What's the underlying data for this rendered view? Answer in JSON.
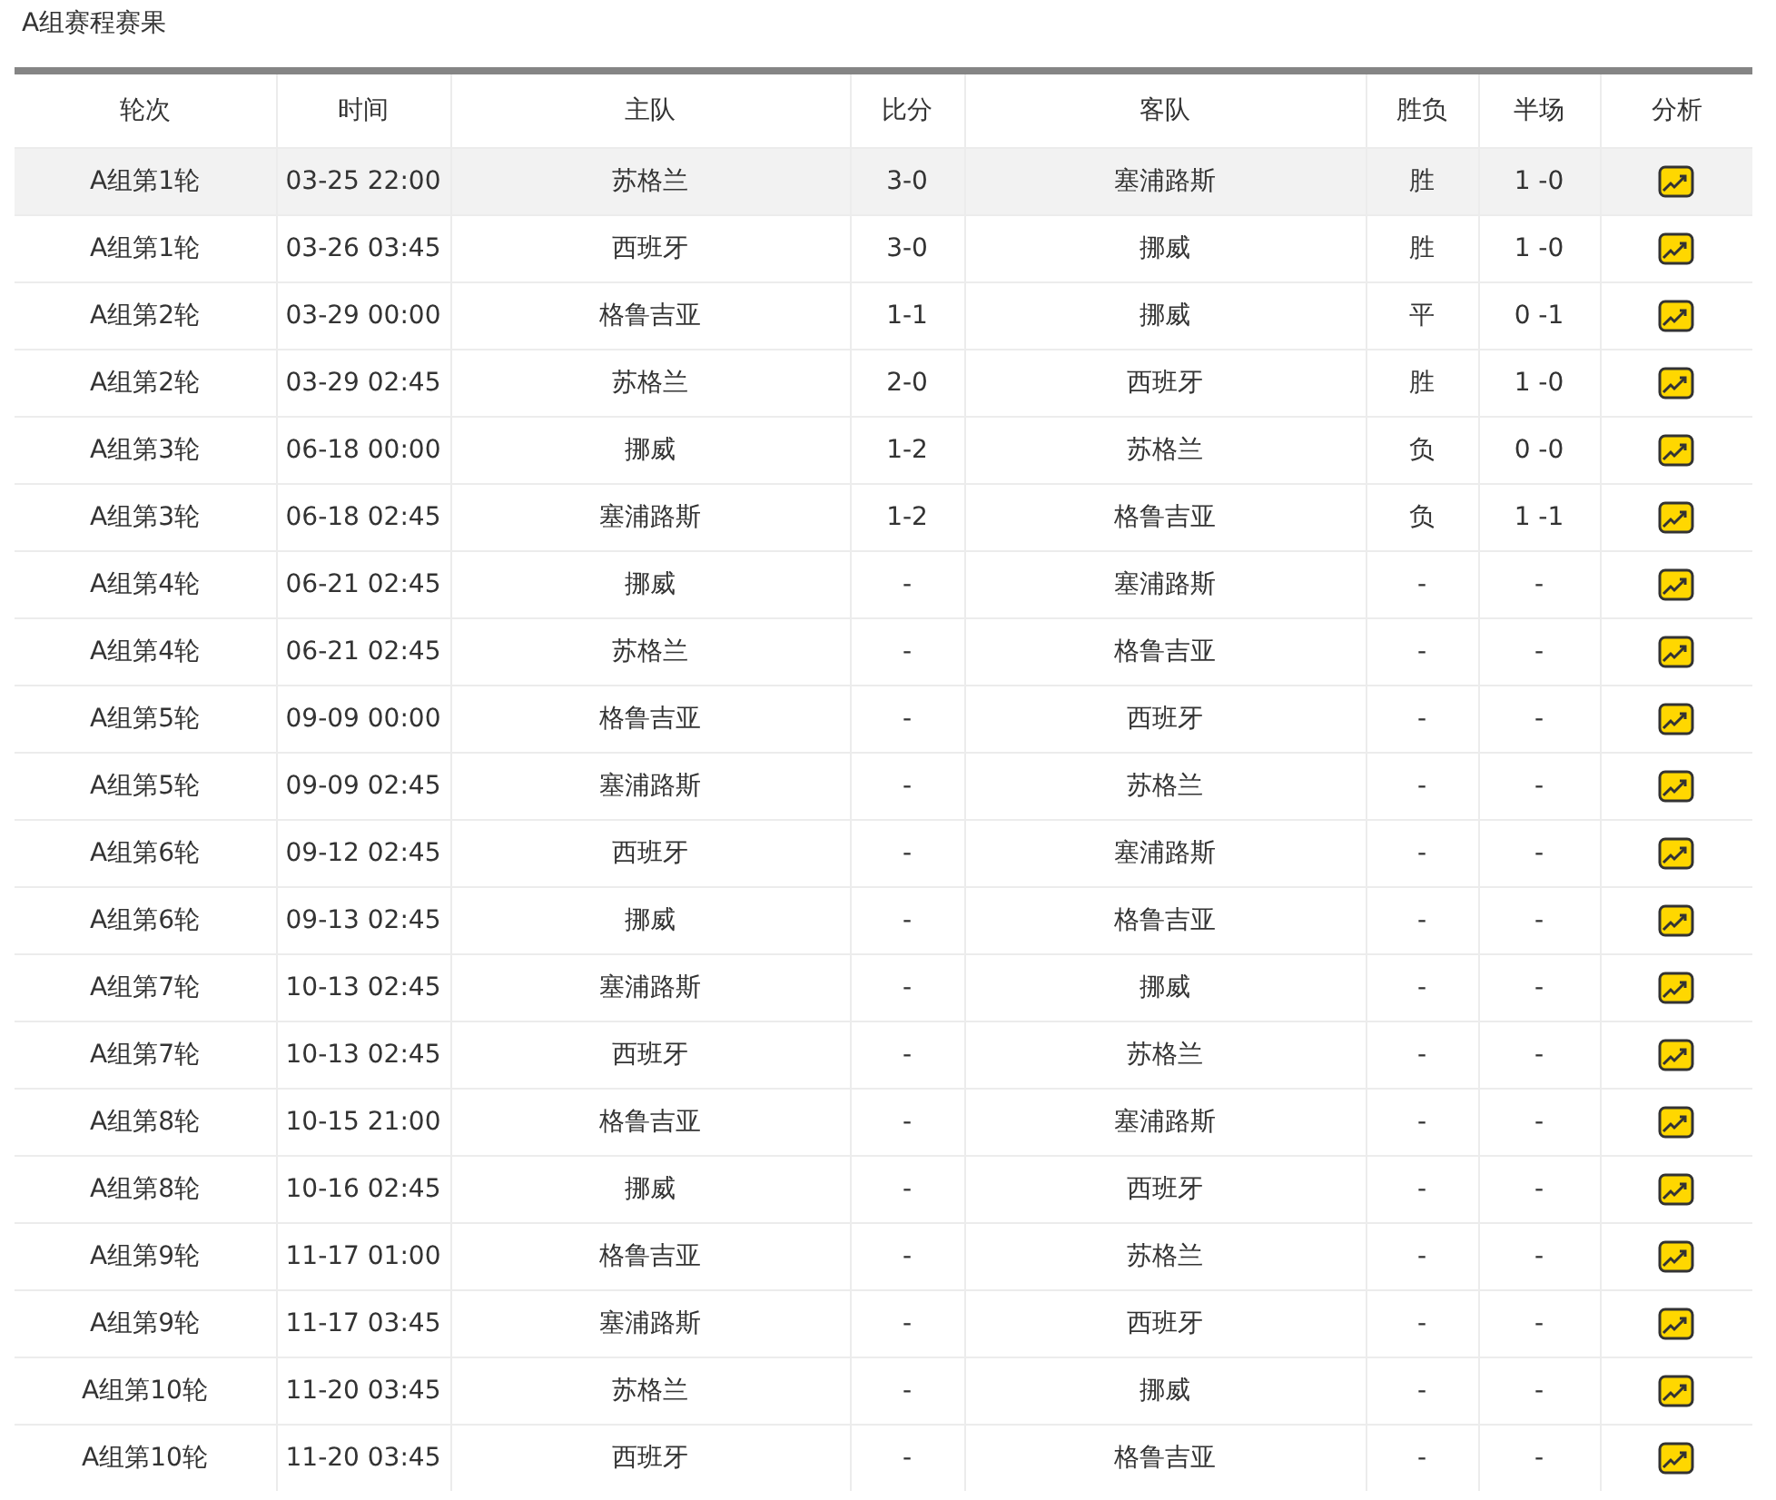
{
  "title": "A组赛程赛果",
  "table": {
    "columns": [
      "轮次",
      "时间",
      "主队",
      "比分",
      "客队",
      "胜负",
      "半场",
      "分析"
    ],
    "rows": [
      {
        "round": "A组第1轮",
        "time": "03-25 22:00",
        "home": "苏格兰",
        "score": "3-0",
        "away": "塞浦路斯",
        "result": "胜",
        "half": "1 -0",
        "highlighted": true
      },
      {
        "round": "A组第1轮",
        "time": "03-26 03:45",
        "home": "西班牙",
        "score": "3-0",
        "away": "挪威",
        "result": "胜",
        "half": "1 -0",
        "highlighted": false
      },
      {
        "round": "A组第2轮",
        "time": "03-29 00:00",
        "home": "格鲁吉亚",
        "score": "1-1",
        "away": "挪威",
        "result": "平",
        "half": "0 -1",
        "highlighted": false
      },
      {
        "round": "A组第2轮",
        "time": "03-29 02:45",
        "home": "苏格兰",
        "score": "2-0",
        "away": "西班牙",
        "result": "胜",
        "half": "1 -0",
        "highlighted": false
      },
      {
        "round": "A组第3轮",
        "time": "06-18 00:00",
        "home": "挪威",
        "score": "1-2",
        "away": "苏格兰",
        "result": "负",
        "half": "0 -0",
        "highlighted": false
      },
      {
        "round": "A组第3轮",
        "time": "06-18 02:45",
        "home": "塞浦路斯",
        "score": "1-2",
        "away": "格鲁吉亚",
        "result": "负",
        "half": "1 -1",
        "highlighted": false
      },
      {
        "round": "A组第4轮",
        "time": "06-21 02:45",
        "home": "挪威",
        "score": "-",
        "away": "塞浦路斯",
        "result": "-",
        "half": "-",
        "highlighted": false
      },
      {
        "round": "A组第4轮",
        "time": "06-21 02:45",
        "home": "苏格兰",
        "score": "-",
        "away": "格鲁吉亚",
        "result": "-",
        "half": "-",
        "highlighted": false
      },
      {
        "round": "A组第5轮",
        "time": "09-09 00:00",
        "home": "格鲁吉亚",
        "score": "-",
        "away": "西班牙",
        "result": "-",
        "half": "-",
        "highlighted": false
      },
      {
        "round": "A组第5轮",
        "time": "09-09 02:45",
        "home": "塞浦路斯",
        "score": "-",
        "away": "苏格兰",
        "result": "-",
        "half": "-",
        "highlighted": false
      },
      {
        "round": "A组第6轮",
        "time": "09-12 02:45",
        "home": "西班牙",
        "score": "-",
        "away": "塞浦路斯",
        "result": "-",
        "half": "-",
        "highlighted": false
      },
      {
        "round": "A组第6轮",
        "time": "09-13 02:45",
        "home": "挪威",
        "score": "-",
        "away": "格鲁吉亚",
        "result": "-",
        "half": "-",
        "highlighted": false
      },
      {
        "round": "A组第7轮",
        "time": "10-13 02:45",
        "home": "塞浦路斯",
        "score": "-",
        "away": "挪威",
        "result": "-",
        "half": "-",
        "highlighted": false
      },
      {
        "round": "A组第7轮",
        "time": "10-13 02:45",
        "home": "西班牙",
        "score": "-",
        "away": "苏格兰",
        "result": "-",
        "half": "-",
        "highlighted": false
      },
      {
        "round": "A组第8轮",
        "time": "10-15 21:00",
        "home": "格鲁吉亚",
        "score": "-",
        "away": "塞浦路斯",
        "result": "-",
        "half": "-",
        "highlighted": false
      },
      {
        "round": "A组第8轮",
        "time": "10-16 02:45",
        "home": "挪威",
        "score": "-",
        "away": "西班牙",
        "result": "-",
        "half": "-",
        "highlighted": false
      },
      {
        "round": "A组第9轮",
        "time": "11-17 01:00",
        "home": "格鲁吉亚",
        "score": "-",
        "away": "苏格兰",
        "result": "-",
        "half": "-",
        "highlighted": false
      },
      {
        "round": "A组第9轮",
        "time": "11-17 03:45",
        "home": "塞浦路斯",
        "score": "-",
        "away": "西班牙",
        "result": "-",
        "half": "-",
        "highlighted": false
      },
      {
        "round": "A组第10轮",
        "time": "11-20 03:45",
        "home": "苏格兰",
        "score": "-",
        "away": "挪威",
        "result": "-",
        "half": "-",
        "highlighted": false
      },
      {
        "round": "A组第10轮",
        "time": "11-20 03:45",
        "home": "西班牙",
        "score": "-",
        "away": "格鲁吉亚",
        "result": "-",
        "half": "-",
        "highlighted": false
      }
    ]
  }
}
